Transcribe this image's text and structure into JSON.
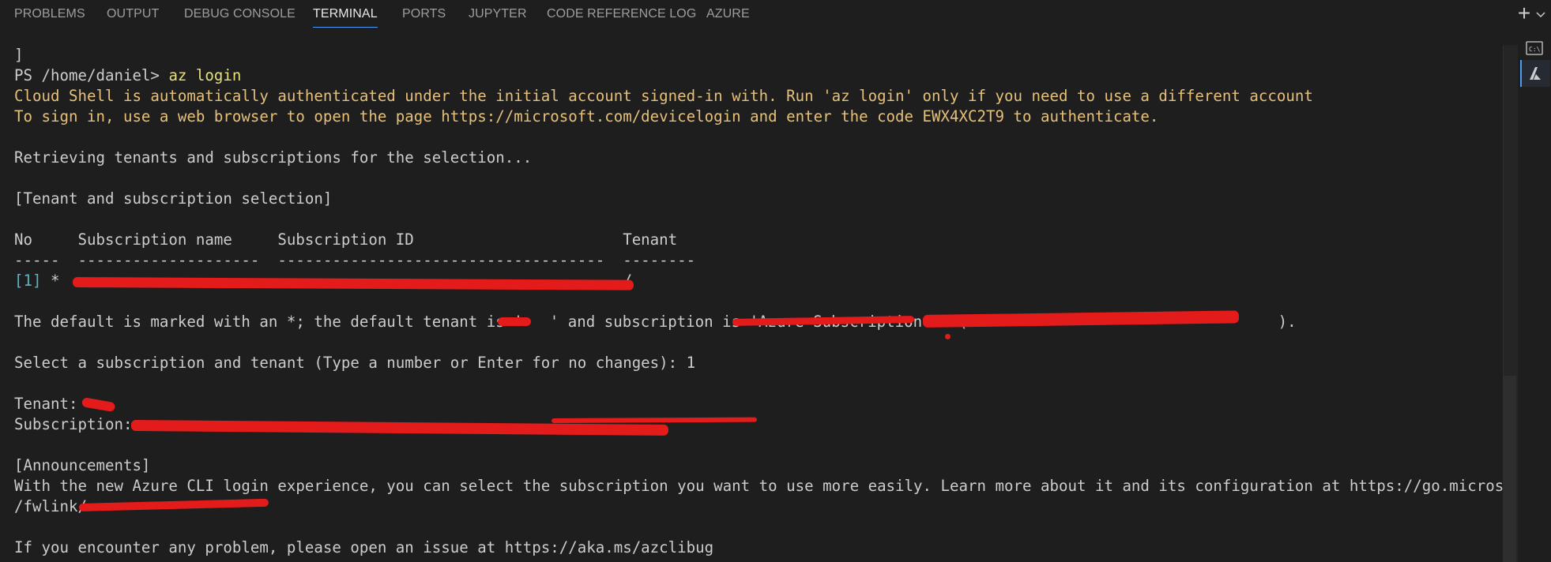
{
  "panel_tabs": [
    "PROBLEMS",
    "OUTPUT",
    "DEBUG CONSOLE",
    "TERMINAL",
    "PORTS",
    "JUPYTER",
    "CODE REFERENCE LOG",
    "AZURE"
  ],
  "active_tab": "TERMINAL",
  "actions": {
    "new_terminal_icon": "plus-icon",
    "dropdown_icon": "chevron-down-icon"
  },
  "side_icons": [
    "powershell-icon",
    "azure-icon"
  ],
  "colors": {
    "background": "#1e1e1e",
    "text": "#cccccc",
    "warning": "#e5c07b",
    "index": "#56b6c2",
    "accent": "#4a9cf5",
    "redaction": "#e31b1b"
  },
  "terminal": {
    "lines": {
      "bracket": "]",
      "prompt": "PS /home/daniel> ",
      "command": "az login",
      "cloud_shell_note": "Cloud Shell is automatically authenticated under the initial account signed-in with. Run 'az login' only if you need to use a different account",
      "sign_in_note": "To sign in, use a web browser to open the page https://microsoft.com/devicelogin and enter the code EWX4XC2T9 to authenticate.",
      "retrieving": "Retrieving tenants and subscriptions for the selection...",
      "selection_header": "[Tenant and subscription selection]",
      "table_header": "No     Subscription name     Subscription ID                       Tenant",
      "table_rule": "-----  --------------------  ------------------------------------  --------",
      "row_index": "[1]",
      "row_rest": " *  ",
      "row_tail": "/",
      "default_prefix": "The default is marked with an *; the default tenant is '",
      "default_mid": "' and subscription is '",
      "default_sub_fragment": "Azure Subscription 1",
      "default_end": "' (",
      "default_close": ").",
      "select_prompt": "Select a subscription and tenant (Type a number or Enter for no changes): 1",
      "tenant_label": "Tenant: ",
      "subscription_label": "Subscription: ",
      "announcements_header": "[Announcements]",
      "announcement_text": "With the new Azure CLI login experience, you can select the subscription you want to use more easily. Learn more about it and its configuration at https://go.microsoft.com",
      "announcement_link_start": "/fwlink/",
      "issue_note": "If you encounter any problem, please open an issue at https://aka.ms/azclibug"
    }
  }
}
